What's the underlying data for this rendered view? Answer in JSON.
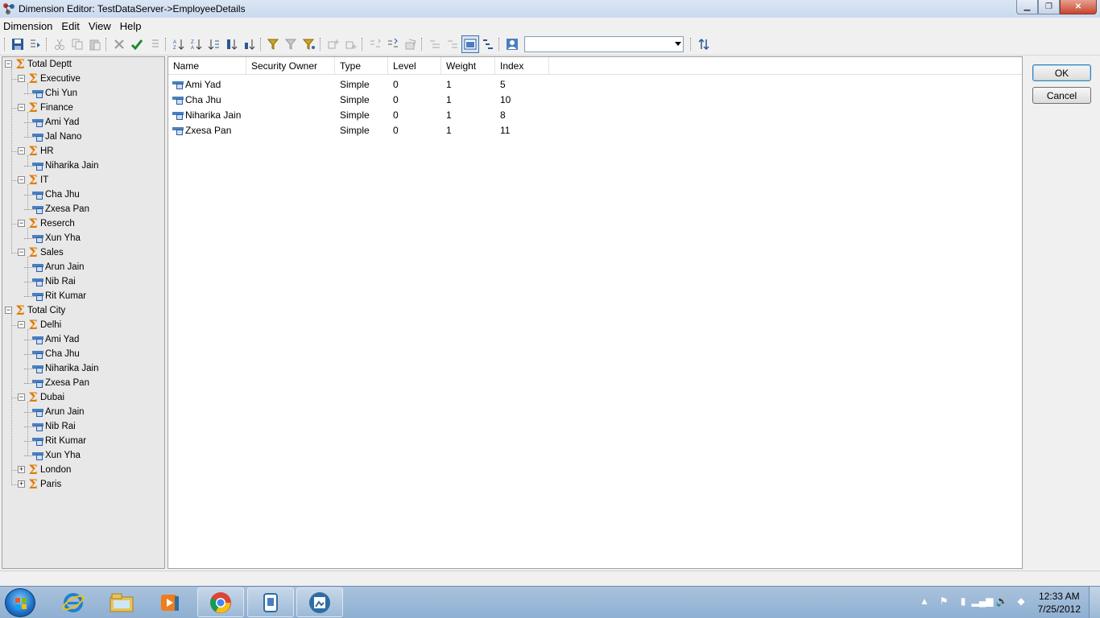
{
  "window": {
    "title": "Dimension Editor: TestDataServer->EmployeeDetails"
  },
  "menu": [
    "Dimension",
    "Edit",
    "View",
    "Help"
  ],
  "toolbar": {
    "combo_value": ""
  },
  "tree": [
    {
      "label": "Total Deptt",
      "level": 0,
      "kind": "sum",
      "expander": "-"
    },
    {
      "label": "Executive",
      "level": 1,
      "kind": "sum",
      "expander": "-"
    },
    {
      "label": "Chi Yun",
      "level": 2,
      "kind": "member"
    },
    {
      "label": "Finance",
      "level": 1,
      "kind": "sum",
      "expander": "-"
    },
    {
      "label": "Ami Yad",
      "level": 2,
      "kind": "member"
    },
    {
      "label": "Jal Nano",
      "level": 2,
      "kind": "member"
    },
    {
      "label": "HR",
      "level": 1,
      "kind": "sum",
      "expander": "-"
    },
    {
      "label": "Niharika Jain",
      "level": 2,
      "kind": "member"
    },
    {
      "label": "IT",
      "level": 1,
      "kind": "sum",
      "expander": "-"
    },
    {
      "label": "Cha Jhu",
      "level": 2,
      "kind": "member"
    },
    {
      "label": "Zxesa Pan",
      "level": 2,
      "kind": "member"
    },
    {
      "label": "Reserch",
      "level": 1,
      "kind": "sum",
      "expander": "-"
    },
    {
      "label": "Xun Yha",
      "level": 2,
      "kind": "member"
    },
    {
      "label": "Sales",
      "level": 1,
      "kind": "sum",
      "expander": "-"
    },
    {
      "label": "Arun Jain",
      "level": 2,
      "kind": "member"
    },
    {
      "label": "Nib Rai",
      "level": 2,
      "kind": "member"
    },
    {
      "label": "Rit Kumar",
      "level": 2,
      "kind": "member"
    },
    {
      "label": "Total City",
      "level": 0,
      "kind": "sum",
      "expander": "-"
    },
    {
      "label": "Delhi",
      "level": 1,
      "kind": "sum",
      "expander": "-"
    },
    {
      "label": "Ami Yad",
      "level": 2,
      "kind": "member"
    },
    {
      "label": "Cha Jhu",
      "level": 2,
      "kind": "member"
    },
    {
      "label": "Niharika Jain",
      "level": 2,
      "kind": "member"
    },
    {
      "label": "Zxesa Pan",
      "level": 2,
      "kind": "member"
    },
    {
      "label": "Dubai",
      "level": 1,
      "kind": "sum",
      "expander": "-"
    },
    {
      "label": "Arun Jain",
      "level": 2,
      "kind": "member"
    },
    {
      "label": "Nib Rai",
      "level": 2,
      "kind": "member"
    },
    {
      "label": "Rit Kumar",
      "level": 2,
      "kind": "member"
    },
    {
      "label": "Xun Yha",
      "level": 2,
      "kind": "member"
    },
    {
      "label": "London",
      "level": 1,
      "kind": "sum",
      "expander": "+"
    },
    {
      "label": "Paris",
      "level": 1,
      "kind": "sum",
      "expander": "+"
    }
  ],
  "list": {
    "columns": [
      "Name",
      "Security Owner",
      "Type",
      "Level",
      "Weight",
      "Index"
    ],
    "rows": [
      [
        "Ami Yad",
        "",
        "Simple",
        "0",
        "1",
        "5"
      ],
      [
        "Cha Jhu",
        "",
        "Simple",
        "0",
        "1",
        "10"
      ],
      [
        "Niharika Jain",
        "",
        "Simple",
        "0",
        "1",
        "8"
      ],
      [
        "Zxesa Pan",
        "",
        "Simple",
        "0",
        "1",
        "11"
      ]
    ]
  },
  "buttons": {
    "ok": "OK",
    "cancel": "Cancel"
  },
  "taskbar": {
    "apps": [
      "start-orb",
      "internet-explorer-icon",
      "explorer-folder-icon",
      "media-player-icon",
      "chrome-icon",
      "app-icon-1",
      "app-icon-2"
    ],
    "clock_time": "12:33 AM",
    "clock_date": "7/25/2012"
  },
  "colors": {
    "sigma": "#e07b00",
    "member_blue": "#4a7fbf",
    "titlebar": "#c9d9ee",
    "taskbar": "#8fb0d2"
  }
}
